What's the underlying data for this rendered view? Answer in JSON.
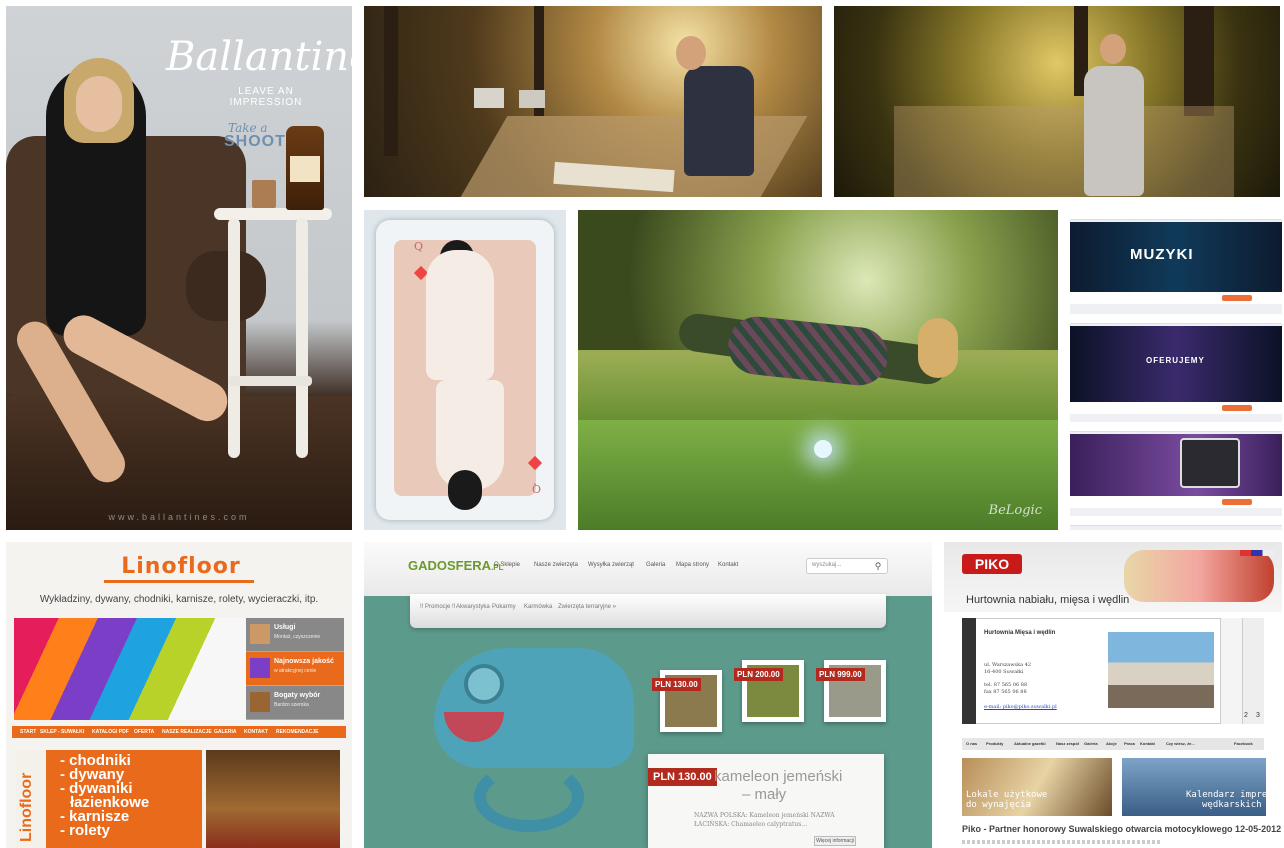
{
  "ballantines": {
    "brand": "Ballantine's",
    "tagline": "LEAVE AN IMPRESSION",
    "take_a": "Take a",
    "shoot": "SHOOT",
    "url": "www.ballantines.com"
  },
  "floating": {
    "signature": "BeLogic"
  },
  "card": {
    "rank": "Q"
  },
  "music_site": {
    "hero1": "MUZYKI",
    "hero2": "OFERUJEMY"
  },
  "linofloor": {
    "logo": "Linofloor",
    "slogan": "Wykładziny, dywany, chodniki, karnisze, rolety, wycieraczki, itp.",
    "side_items": [
      {
        "label": "Usługi",
        "sub": "Montaż, czyszczenie"
      },
      {
        "label": "Najnowsza jakość",
        "sub": "w atrakcyjnej cenie"
      },
      {
        "label": "Bogaty wybór",
        "sub": "Bardzo szeroka"
      }
    ],
    "nav": [
      "START",
      "SKLEP - SUWAŁKI",
      "KATALOGI PDF",
      "OFERTA",
      "NASZE REALIZACJE",
      "GALERIA",
      "KONTAKT",
      "REKOMENDACJE"
    ],
    "promo_brand": "Linofloor",
    "promo_lines": [
      "- chodniki",
      "- dywany",
      "- dywaniki",
      "łazienkowe",
      "- karnisze",
      "- rolety"
    ]
  },
  "gadosfera": {
    "logo": "GADOSFERA",
    "logo_suffix": ".PL",
    "nav": [
      "O Sklepie",
      "Nasze zwierzęta",
      "Wysyłka zwierząt",
      "Galeria",
      "Mapa strony",
      "Kontakt"
    ],
    "search_placeholder": "wyszukaj...",
    "search_icon": "magnifier-icon",
    "sub_nav": [
      "!! Promocje !!",
      "Akwarystyka",
      "Pokarmy",
      "Karmówka",
      "Zwierzęta terraryjne »"
    ],
    "thumb_prices": [
      "PLN 130.00",
      "PLN 200.00",
      "PLN 999.00"
    ],
    "featured": {
      "price": "PLN 130.00",
      "title": "kameleon jemeński",
      "title2": "– mały",
      "desc1": "NAZWA POLSKA: Kameleon jemeński NAZWA",
      "desc2": "ŁACIŃSKA: Chamaeleo calyptratus...",
      "more": "Więcej informacji"
    }
  },
  "piko": {
    "logo": "PIKO",
    "title": "Hurtownia nabiału, mięsa i wędlin",
    "box_heading": "Hurtownia Mięsa i wędlin",
    "address": [
      "ul. Warszawska 42",
      "16-400 Suwałki",
      "tel. 87 565 06 88",
      "fax 87 565 06 88",
      "e-mail: piko@piko.suwalki.pl"
    ],
    "slider_numbers": [
      "1",
      "2",
      "3"
    ],
    "menu": [
      "O nas",
      "Produkty",
      "Aktualne gazetki",
      "Nasz zespół",
      "Galeria",
      "Akcje",
      "Praca",
      "Kontakt",
      "Czy wiesz, że...",
      "Facebook"
    ],
    "banner_left": [
      "Lokale użytkowe",
      "do wynajęcia"
    ],
    "banner_right": [
      "Kalendarz imprez",
      "wędkarskich"
    ],
    "news_title": "Piko - Partner honorowy Suwalskiego otwarcia motocyklowego 12-05-2012"
  }
}
